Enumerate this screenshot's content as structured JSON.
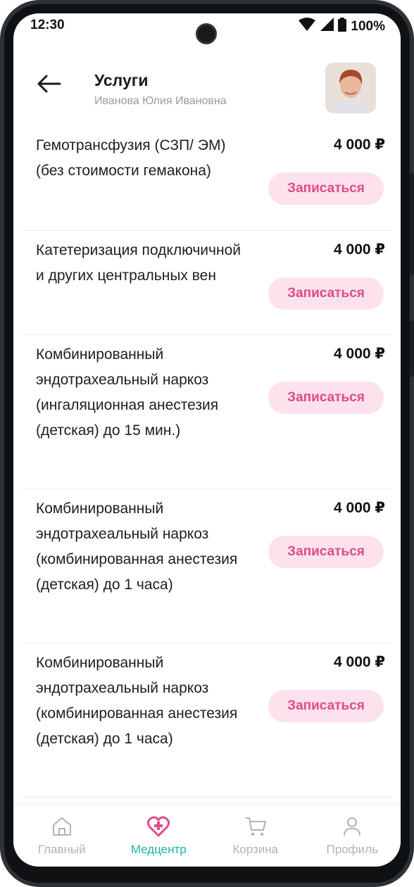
{
  "status_bar": {
    "time": "12:30",
    "battery": "100%"
  },
  "header": {
    "title": "Услуги",
    "subtitle": "Иванова Юлия Ивановна"
  },
  "services": [
    {
      "name": "Гемотрансфузия (СЗП/ ЭМ) (без стоимости гемакона)",
      "price": "4 000 ₽",
      "button": "Записаться"
    },
    {
      "name": "Катетеризация подключичной и других центральных вен",
      "price": "4 000 ₽",
      "button": "Записаться"
    },
    {
      "name": "Комбинированный эндотрахеальный наркоз (ингаляционная анестезия (детская) до 15 мин.)",
      "price": "4 000 ₽",
      "button": "Записаться"
    },
    {
      "name": "Комбинированный эндотрахеальный наркоз (комбинированная анестезия (детская) до 1 часа)",
      "price": "4 000 ₽",
      "button": "Записаться"
    },
    {
      "name": "Комбинированный эндотрахеальный наркоз (комбинированная анестезия (детская) до 1 часа)",
      "price": "4 000 ₽",
      "button": "Записаться"
    }
  ],
  "bottom_nav": [
    {
      "label": "Главный",
      "icon": "home-icon"
    },
    {
      "label": "Медцентр",
      "icon": "medical-heart-icon",
      "active": true
    },
    {
      "label": "Корзина",
      "icon": "cart-icon"
    },
    {
      "label": "Профиль",
      "icon": "profile-icon"
    }
  ],
  "colors": {
    "accent_pink": "#e04b86",
    "pink_bg": "#fde2ee",
    "active_teal": "#21b0a6"
  }
}
